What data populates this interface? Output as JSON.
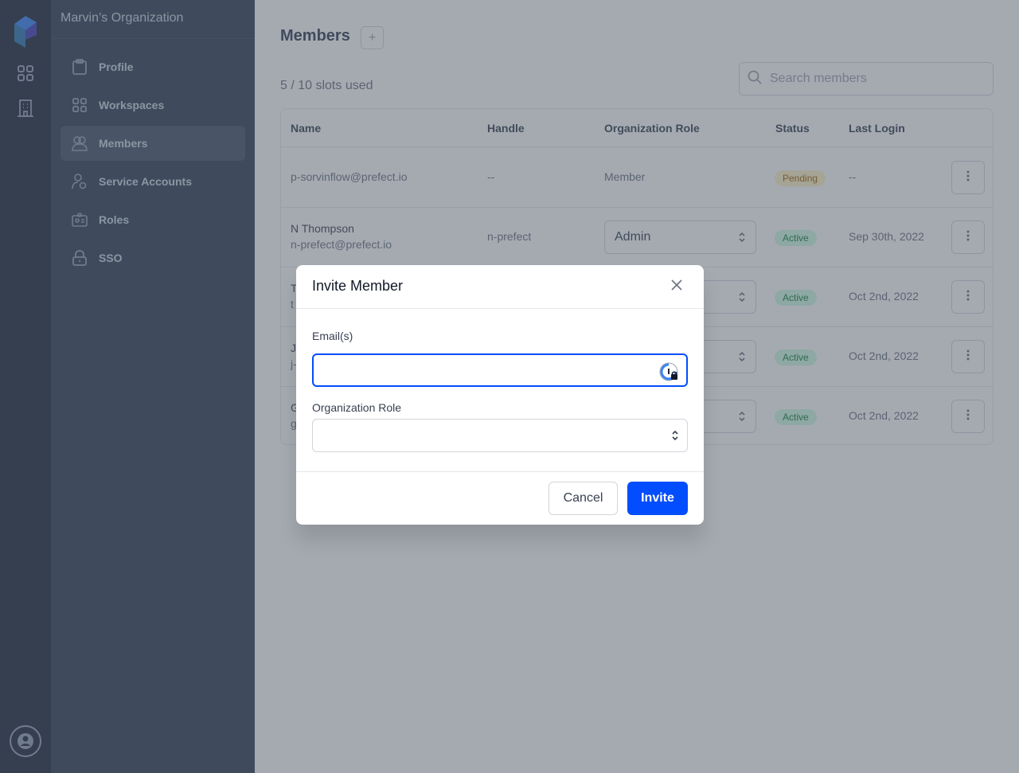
{
  "rail": {
    "icons": [
      "prefect-logo-icon",
      "workspaces-grid-icon",
      "organization-building-icon",
      "user-account-icon"
    ]
  },
  "subnav": {
    "org_title": "Marvin’s Organization",
    "items": [
      {
        "label": "Profile",
        "icon": "clipboard-icon",
        "active": false
      },
      {
        "label": "Workspaces",
        "icon": "grid-icon",
        "active": false
      },
      {
        "label": "Members",
        "icon": "users-icon",
        "active": true
      },
      {
        "label": "Service Accounts",
        "icon": "user-gear-icon",
        "active": false
      },
      {
        "label": "Roles",
        "icon": "id-badge-icon",
        "active": false
      },
      {
        "label": "SSO",
        "icon": "lock-icon",
        "active": false
      }
    ]
  },
  "main": {
    "title": "Members",
    "add_label": "+",
    "slots": "5 / 10 slots used",
    "search_placeholder": "Search members",
    "columns": [
      "Name",
      "Handle",
      "Organization Role",
      "Status",
      "Last Login"
    ],
    "rows": [
      {
        "name": "",
        "email": "p-sorvinflow@prefect.io",
        "handle": "--",
        "role": "Member",
        "role_editable": false,
        "status": "Pending",
        "last_login": "--"
      },
      {
        "name": "N Thompson",
        "email": "n-prefect@prefect.io",
        "handle": "n-prefect",
        "role": "Admin",
        "role_editable": true,
        "status": "Active",
        "last_login": "Sep 30th, 2022"
      },
      {
        "name": "T",
        "email": "t",
        "handle": "",
        "role": "",
        "role_editable": true,
        "status": "Active",
        "last_login": "Oct 2nd, 2022"
      },
      {
        "name": "J",
        "email": "j-",
        "handle": "",
        "role": "",
        "role_editable": true,
        "status": "Active",
        "last_login": "Oct 2nd, 2022"
      },
      {
        "name": "G",
        "email": "g",
        "handle": "",
        "role": "",
        "role_editable": true,
        "status": "Active",
        "last_login": "Oct 2nd, 2022"
      }
    ]
  },
  "modal": {
    "title": "Invite Member",
    "email_label": "Email(s)",
    "email_value": "",
    "role_label": "Organization Role",
    "role_value": "",
    "cancel_label": "Cancel",
    "invite_label": "Invite"
  },
  "colors": {
    "accent": "#024dfd",
    "pending_bg": "#fef3c7",
    "active_bg": "#d1fae5"
  }
}
